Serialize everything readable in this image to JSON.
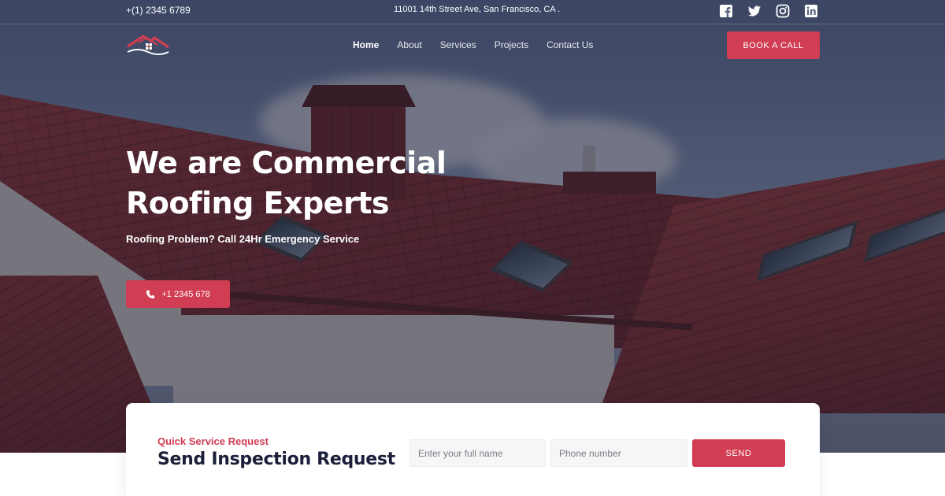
{
  "topbar": {
    "phone": "+(1) 2345 6789",
    "address": "11001 14th Street Ave, San Francisco, CA .",
    "socials": [
      "facebook-icon",
      "twitter-icon",
      "instagram-icon",
      "linkedin-icon"
    ]
  },
  "nav": {
    "items": [
      {
        "label": "Home",
        "active": true
      },
      {
        "label": "About",
        "active": false
      },
      {
        "label": "Services",
        "active": false
      },
      {
        "label": "Projects",
        "active": false
      },
      {
        "label": "Contact Us",
        "active": false
      }
    ],
    "cta_label": "BOOK A CALL"
  },
  "hero": {
    "title_line1": "We are Commercial",
    "title_line2": "Roofing Experts",
    "subtitle": "Roofing Problem? Call 24Hr Emergency Service",
    "call_label": "+1 2345 678"
  },
  "request": {
    "kicker": "Quick Service Request",
    "title": "Send Inspection Request",
    "name_placeholder": "Enter your full name",
    "phone_placeholder": "Phone number",
    "send_label": "SEND"
  },
  "colors": {
    "accent": "#d13d52",
    "dark_text": "#1b1f3a"
  }
}
